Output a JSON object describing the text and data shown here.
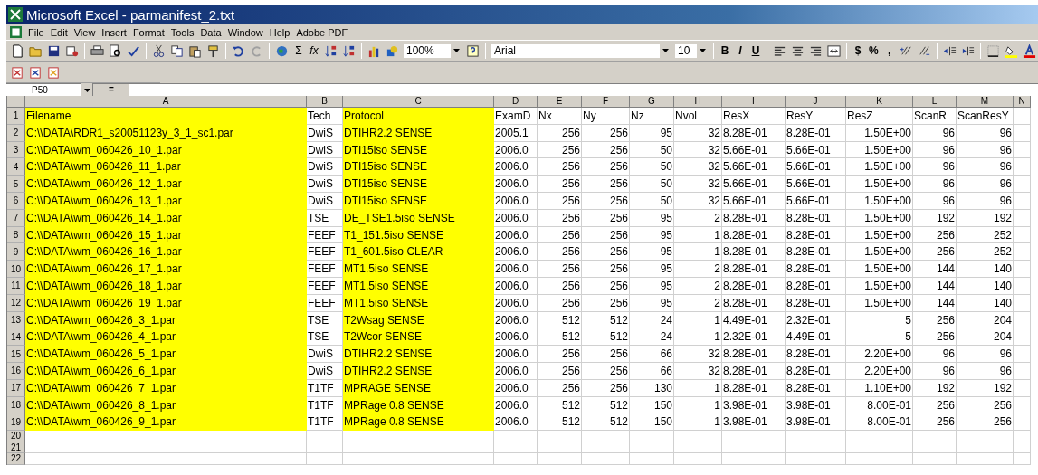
{
  "window": {
    "title": "Microsoft Excel - parmanifest_2.txt"
  },
  "menu": [
    "File",
    "Edit",
    "View",
    "Insert",
    "Format",
    "Tools",
    "Data",
    "Window",
    "Help",
    "Adobe PDF"
  ],
  "toolbar": {
    "sum": "Σ",
    "function": "fx",
    "zoom": "100%",
    "font": "Arial",
    "size": "10",
    "bold": "B",
    "italic": "I",
    "underline": "U",
    "currency": "$",
    "percent": "%",
    "comma": ","
  },
  "formula_bar": {
    "name_box": "P50",
    "equals": "="
  },
  "columns": [
    {
      "label": "A",
      "kind": "text",
      "highlighted": true
    },
    {
      "label": "B",
      "kind": "text",
      "highlighted": false
    },
    {
      "label": "C",
      "kind": "text",
      "highlighted": true
    },
    {
      "label": "D",
      "kind": "text",
      "highlighted": false
    },
    {
      "label": "E",
      "kind": "number",
      "highlighted": false
    },
    {
      "label": "F",
      "kind": "number",
      "highlighted": false
    },
    {
      "label": "G",
      "kind": "number",
      "highlighted": false
    },
    {
      "label": "H",
      "kind": "number",
      "highlighted": false
    },
    {
      "label": "I",
      "kind": "text",
      "highlighted": false
    },
    {
      "label": "J",
      "kind": "text",
      "highlighted": false
    },
    {
      "label": "K",
      "kind": "number",
      "highlighted": false
    },
    {
      "label": "L",
      "kind": "number",
      "highlighted": false
    },
    {
      "label": "M",
      "kind": "number",
      "highlighted": false
    },
    {
      "label": "N",
      "kind": "text",
      "highlighted": false
    }
  ],
  "rows": [
    {
      "number": "1",
      "kind": "header",
      "cells": [
        "Filename",
        "Tech",
        "Protocol",
        "ExamD",
        "Nx",
        "Ny",
        "Nz",
        "Nvol",
        "ResX",
        "ResY",
        "ResZ",
        "ScanR",
        "ScanResY"
      ]
    },
    {
      "number": "2",
      "kind": "data",
      "cells": [
        "C:\\\\DATA\\RDR1_s20051123y_3_1_sc1.par",
        "DwiS",
        "DTIHR2.2 SENSE",
        "2005.1",
        "256",
        "256",
        "95",
        "32",
        "8.28E-01",
        "8.28E-01",
        "1.50E+00",
        "96",
        "96"
      ]
    },
    {
      "number": "3",
      "kind": "data",
      "cells": [
        "C:\\\\DATA\\wm_060426_10_1.par",
        "DwiS",
        "DTI15iso SENSE",
        "2006.0",
        "256",
        "256",
        "50",
        "32",
        "5.66E-01",
        "5.66E-01",
        "1.50E+00",
        "96",
        "96"
      ]
    },
    {
      "number": "4",
      "kind": "data",
      "cells": [
        "C:\\\\DATA\\wm_060426_11_1.par",
        "DwiS",
        "DTI15iso SENSE",
        "2006.0",
        "256",
        "256",
        "50",
        "32",
        "5.66E-01",
        "5.66E-01",
        "1.50E+00",
        "96",
        "96"
      ]
    },
    {
      "number": "5",
      "kind": "data",
      "cells": [
        "C:\\\\DATA\\wm_060426_12_1.par",
        "DwiS",
        "DTI15iso SENSE",
        "2006.0",
        "256",
        "256",
        "50",
        "32",
        "5.66E-01",
        "5.66E-01",
        "1.50E+00",
        "96",
        "96"
      ]
    },
    {
      "number": "6",
      "kind": "data",
      "cells": [
        "C:\\\\DATA\\wm_060426_13_1.par",
        "DwiS",
        "DTI15iso SENSE",
        "2006.0",
        "256",
        "256",
        "50",
        "32",
        "5.66E-01",
        "5.66E-01",
        "1.50E+00",
        "96",
        "96"
      ]
    },
    {
      "number": "7",
      "kind": "data",
      "cells": [
        "C:\\\\DATA\\wm_060426_14_1.par",
        "TSE",
        "DE_TSE1.5iso SENSE",
        "2006.0",
        "256",
        "256",
        "95",
        "2",
        "8.28E-01",
        "8.28E-01",
        "1.50E+00",
        "192",
        "192"
      ]
    },
    {
      "number": "8",
      "kind": "data",
      "cells": [
        "C:\\\\DATA\\wm_060426_15_1.par",
        "FEEF",
        "T1_151.5iso SENSE",
        "2006.0",
        "256",
        "256",
        "95",
        "1",
        "8.28E-01",
        "8.28E-01",
        "1.50E+00",
        "256",
        "252"
      ]
    },
    {
      "number": "9",
      "kind": "data",
      "cells": [
        "C:\\\\DATA\\wm_060426_16_1.par",
        "FEEF",
        "T1_601.5iso CLEAR",
        "2006.0",
        "256",
        "256",
        "95",
        "1",
        "8.28E-01",
        "8.28E-01",
        "1.50E+00",
        "256",
        "252"
      ]
    },
    {
      "number": "10",
      "kind": "data",
      "cells": [
        "C:\\\\DATA\\wm_060426_17_1.par",
        "FEEF",
        "MT1.5iso SENSE",
        "2006.0",
        "256",
        "256",
        "95",
        "2",
        "8.28E-01",
        "8.28E-01",
        "1.50E+00",
        "144",
        "140"
      ]
    },
    {
      "number": "11",
      "kind": "data",
      "cells": [
        "C:\\\\DATA\\wm_060426_18_1.par",
        "FEEF",
        "MT1.5iso SENSE",
        "2006.0",
        "256",
        "256",
        "95",
        "2",
        "8.28E-01",
        "8.28E-01",
        "1.50E+00",
        "144",
        "140"
      ]
    },
    {
      "number": "12",
      "kind": "data",
      "cells": [
        "C:\\\\DATA\\wm_060426_19_1.par",
        "FEEF",
        "MT1.5iso SENSE",
        "2006.0",
        "256",
        "256",
        "95",
        "2",
        "8.28E-01",
        "8.28E-01",
        "1.50E+00",
        "144",
        "140"
      ]
    },
    {
      "number": "13",
      "kind": "data",
      "cells": [
        "C:\\\\DATA\\wm_060426_3_1.par",
        "TSE",
        "T2Wsag SENSE",
        "2006.0",
        "512",
        "512",
        "24",
        "1",
        "4.49E-01",
        "2.32E-01",
        "5",
        "256",
        "204"
      ]
    },
    {
      "number": "14",
      "kind": "data",
      "cells": [
        "C:\\\\DATA\\wm_060426_4_1.par",
        "TSE",
        "T2Wcor SENSE",
        "2006.0",
        "512",
        "512",
        "24",
        "1",
        "2.32E-01",
        "4.49E-01",
        "5",
        "256",
        "204"
      ]
    },
    {
      "number": "15",
      "kind": "data",
      "cells": [
        "C:\\\\DATA\\wm_060426_5_1.par",
        "DwiS",
        "DTIHR2.2 SENSE",
        "2006.0",
        "256",
        "256",
        "66",
        "32",
        "8.28E-01",
        "8.28E-01",
        "2.20E+00",
        "96",
        "96"
      ]
    },
    {
      "number": "16",
      "kind": "data",
      "cells": [
        "C:\\\\DATA\\wm_060426_6_1.par",
        "DwiS",
        "DTIHR2.2 SENSE",
        "2006.0",
        "256",
        "256",
        "66",
        "32",
        "8.28E-01",
        "8.28E-01",
        "2.20E+00",
        "96",
        "96"
      ]
    },
    {
      "number": "17",
      "kind": "data",
      "cells": [
        "C:\\\\DATA\\wm_060426_7_1.par",
        "T1TF",
        "MPRAGE SENSE",
        "2006.0",
        "256",
        "256",
        "130",
        "1",
        "8.28E-01",
        "8.28E-01",
        "1.10E+00",
        "192",
        "192"
      ]
    },
    {
      "number": "18",
      "kind": "data",
      "cells": [
        "C:\\\\DATA\\wm_060426_8_1.par",
        "T1TF",
        "MPRage 0.8 SENSE",
        "2006.0",
        "512",
        "512",
        "150",
        "1",
        "3.98E-01",
        "3.98E-01",
        "8.00E-01",
        "256",
        "256"
      ]
    },
    {
      "number": "19",
      "kind": "data",
      "cells": [
        "C:\\\\DATA\\wm_060426_9_1.par",
        "T1TF",
        "MPRage 0.8 SENSE",
        "2006.0",
        "512",
        "512",
        "150",
        "1",
        "3.98E-01",
        "3.98E-01",
        "8.00E-01",
        "256",
        "256"
      ]
    },
    {
      "number": "20",
      "kind": "empty"
    },
    {
      "number": "21",
      "kind": "empty"
    },
    {
      "number": "22",
      "kind": "empty"
    }
  ]
}
